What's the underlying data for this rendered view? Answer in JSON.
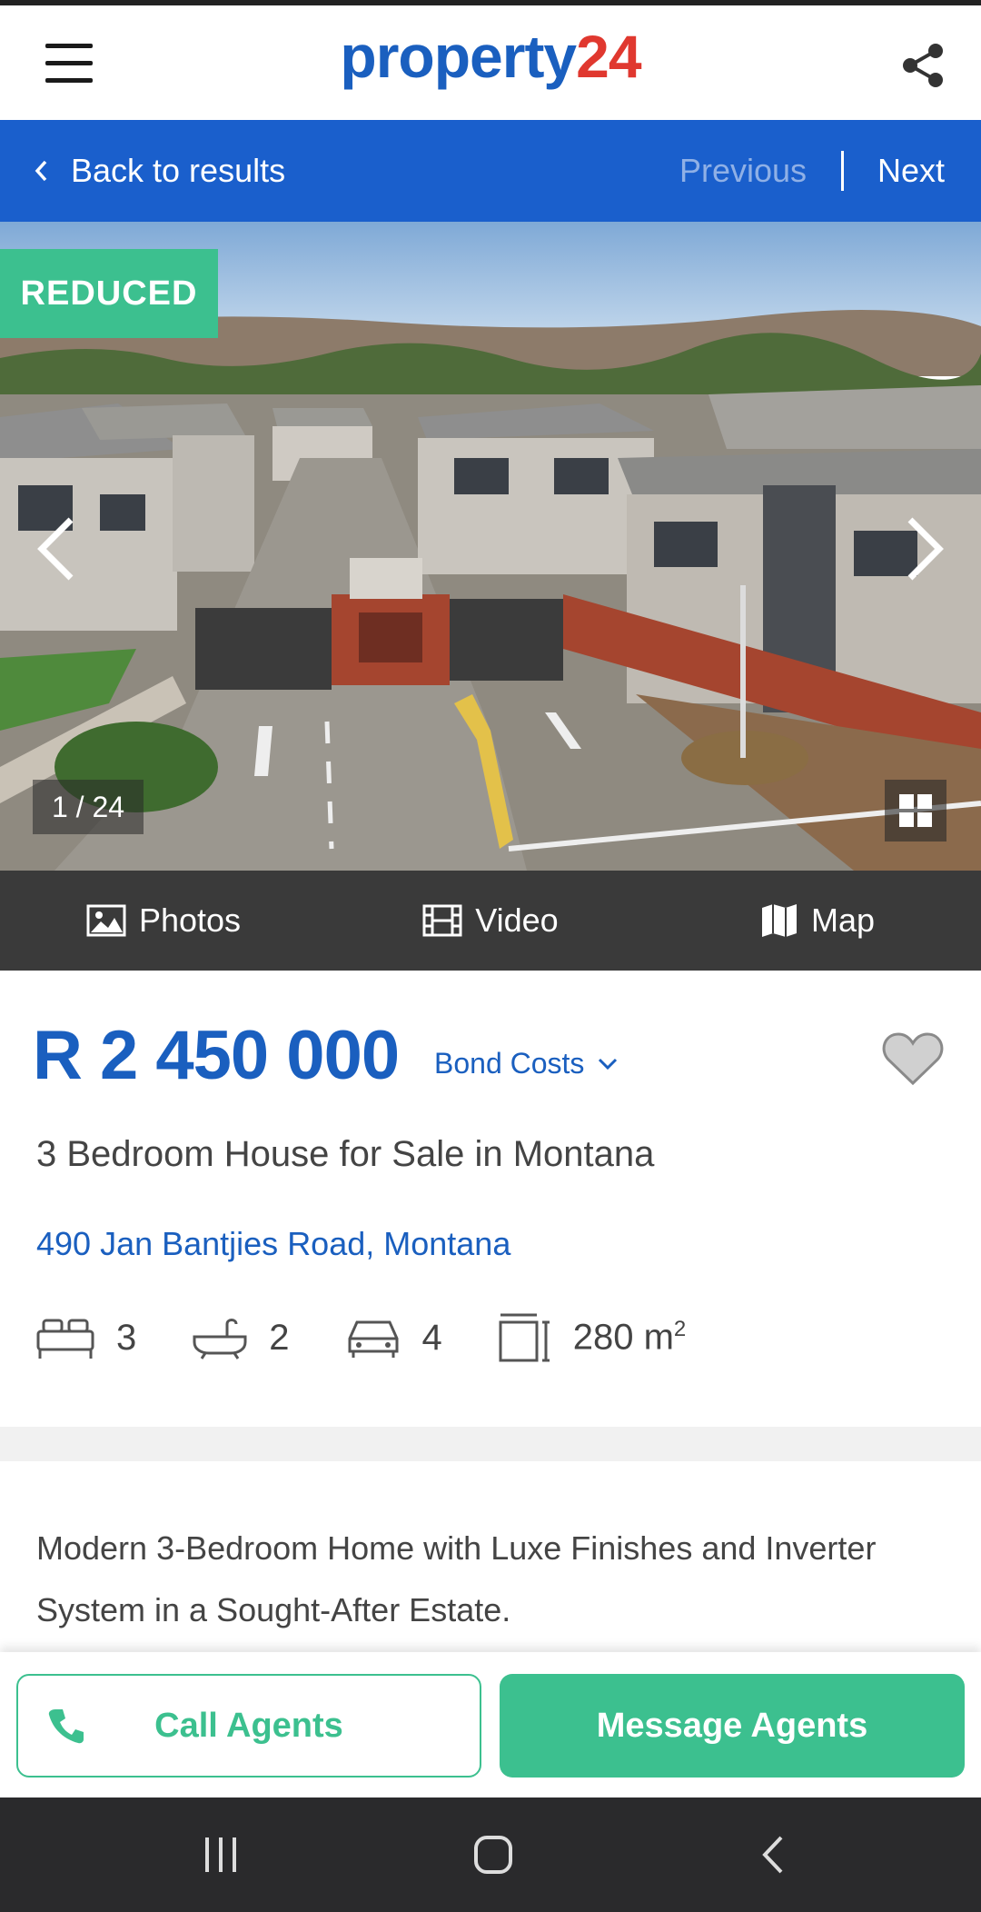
{
  "header": {
    "logo_part1": "property",
    "logo_part2": "24",
    "brand_blue": "#1a5fbf",
    "brand_red": "#e0382f"
  },
  "navbar": {
    "back_label": "Back to results",
    "previous_label": "Previous",
    "next_label": "Next",
    "bg_color": "#1a5fcc"
  },
  "gallery": {
    "badge": "REDUCED",
    "counter": "1 / 24",
    "badge_color": "#3cc08f"
  },
  "media": {
    "photos_label": "Photos",
    "video_label": "Video",
    "map_label": "Map"
  },
  "listing": {
    "price": "R 2 450 000",
    "bond_costs_label": "Bond Costs",
    "title": "3 Bedroom House for Sale in Montana",
    "address": "490 Jan Bantjies Road, Montana",
    "bedrooms": "3",
    "bathrooms": "2",
    "parking": "4",
    "floor_size": "280 m",
    "floor_size_unit_sup": "2",
    "description": "Modern 3-Bedroom Home with Luxe Finishes and Inverter System in a Sought-After Estate."
  },
  "actions": {
    "call_label": "Call Agents",
    "message_label": "Message Agents",
    "accent_color": "#3cc08f"
  },
  "icons": [
    "menu-icon",
    "share-icon",
    "chevron-left-icon",
    "chevron-right-icon",
    "image-icon",
    "film-icon",
    "map-icon",
    "chevron-down-icon",
    "heart-icon",
    "bed-icon",
    "bath-icon",
    "car-icon",
    "floor-size-icon",
    "phone-icon",
    "grid-icon",
    "recent-apps-icon",
    "home-icon",
    "back-icon"
  ]
}
